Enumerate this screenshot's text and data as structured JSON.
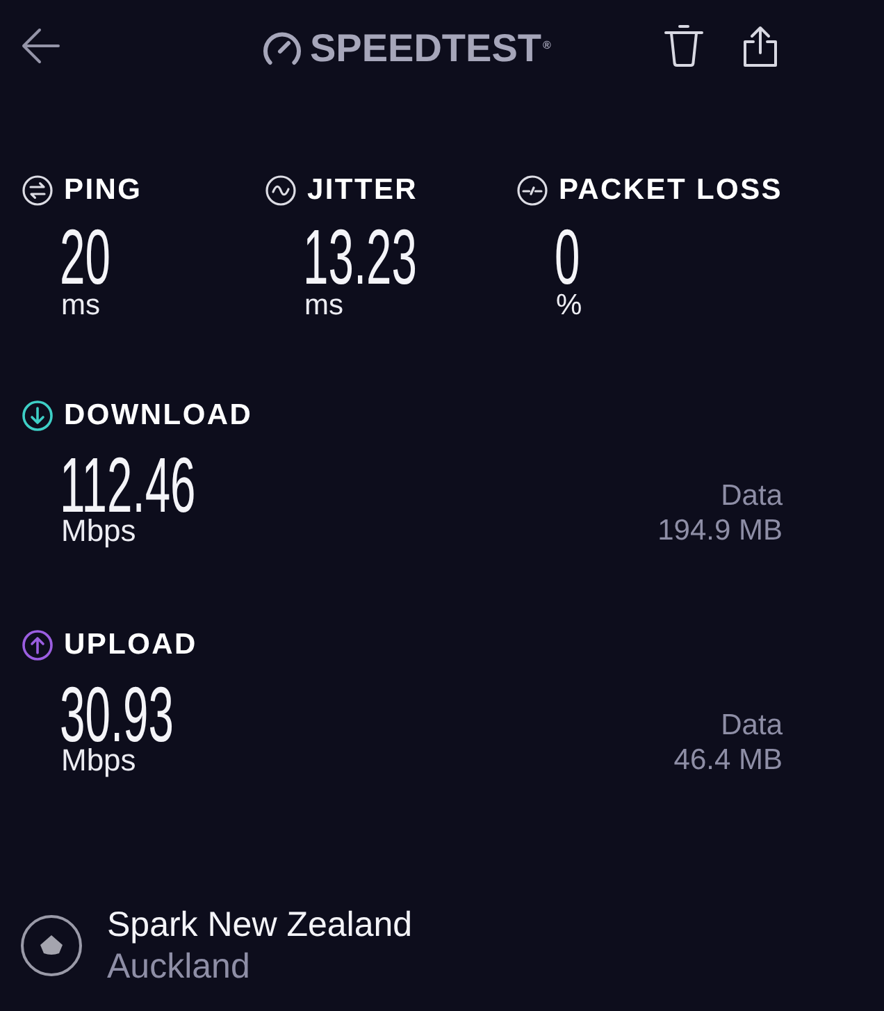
{
  "header": {
    "logo": "SPEEDTEST$^{®}$"
  },
  "metrics": [
    {
      "kind": "ping",
      "label": "PING",
      "value": "20",
      "unit": "ms"
    },
    {
      "kind": "jitter",
      "label": "JITTER",
      "value": "13.23",
      "unit": "ms"
    },
    {
      "kind": "packet_loss",
      "label": "PACKET LOSS",
      "value": "0",
      "unit": "%"
    }
  ],
  "results": [
    {
      "kind": "download",
      "label": "DOWNLOAD",
      "color": "#3ecfc6",
      "value": "112.46",
      "unit": "Mbps",
      "data_label": "Data",
      "data_value": "194.9 MB"
    },
    {
      "kind": "upload",
      "label": "UPLOAD",
      "color": "#9b5ee0",
      "value": "30.93",
      "unit": "Mbps",
      "data_label": "Data",
      "data_value": "46.4 MB"
    }
  ],
  "server": {
    "name": "Spark New Zealand",
    "location": "Auckland"
  }
}
